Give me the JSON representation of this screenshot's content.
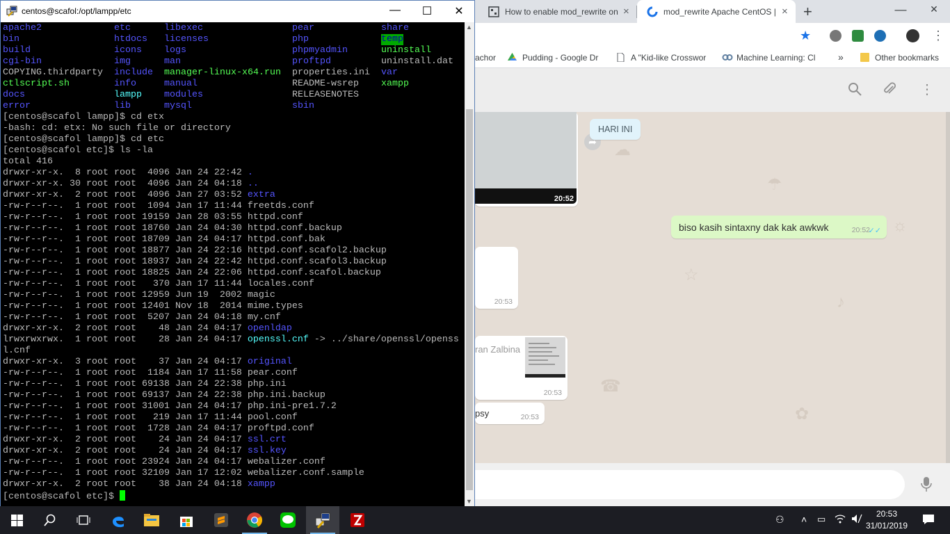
{
  "chrome": {
    "tabs": [
      {
        "title": "How to enable mod_rewrite on",
        "close": "×"
      },
      {
        "title": "mod_rewrite Apache CentOS |",
        "close": "×"
      }
    ],
    "new_tab": "+",
    "window_controls": {
      "minimize": "—",
      "maximize": "❐",
      "close": "✕"
    },
    "bookmarks": [
      {
        "label": "achor",
        "icon": "bookmark-page-icon"
      },
      {
        "label": "Pudding - Google Dr",
        "icon": "google-drive-icon"
      },
      {
        "label": "A \"Kid-like Crosswor",
        "icon": "page-icon"
      },
      {
        "label": "Machine Learning: Cl",
        "icon": "link-icon"
      }
    ],
    "bookmarks_overflow": "»",
    "other_bookmarks": "Other bookmarks",
    "colors": {
      "accent": "#1a73e8",
      "tabstrip": "#dee1e6"
    }
  },
  "whatsapp": {
    "date_chip": "HARI INI",
    "image_time": "20:52",
    "outgoing": {
      "text": "biso kasih sintaxny dak kak awkwk",
      "time": "20:52",
      "ticks": "✓✓"
    },
    "incoming": [
      {
        "text": "",
        "time": "20:53"
      },
      {
        "text": "ran Zalbina",
        "time": "20:53"
      },
      {
        "text": "psy",
        "time": "20:53"
      }
    ],
    "colors": {
      "bg": "#e5ddd5",
      "outgoing": "#dcf8c6",
      "header": "#ededed"
    }
  },
  "putty": {
    "title": "centos@scafol:/opt/lampp/etc",
    "window_controls": {
      "minimize": "—",
      "maximize": "☐",
      "close": "✕"
    },
    "ls_rows": [
      [
        "apache2",
        "etc",
        "libexec",
        "pear",
        "share"
      ],
      [
        "bin",
        "htdocs",
        "licenses",
        "php",
        "temp"
      ],
      [
        "build",
        "icons",
        "logs",
        "phpmyadmin",
        "uninstall"
      ],
      [
        "cgi-bin",
        "img",
        "man",
        "proftpd",
        "uninstall.dat"
      ],
      [
        "COPYING.thirdparty",
        "include",
        "manager-linux-x64.run",
        "properties.ini",
        "var"
      ],
      [
        "ctlscript.sh",
        "info",
        "manual",
        "README-wsrep",
        "xampp"
      ],
      [
        "docs",
        "lampp",
        "modules",
        "RELEASENOTES",
        ""
      ],
      [
        "error",
        "lib",
        "mysql",
        "sbin",
        ""
      ]
    ],
    "ls_colors": [
      [
        "blu",
        "blu",
        "blu",
        "blu",
        "blu"
      ],
      [
        "blu",
        "blu",
        "blu",
        "blu",
        "hl"
      ],
      [
        "blu",
        "blu",
        "blu",
        "blu",
        "grn"
      ],
      [
        "blu",
        "blu",
        "blu",
        "blu",
        "plain"
      ],
      [
        "plain",
        "blu",
        "grn",
        "plain",
        "blu"
      ],
      [
        "grn",
        "blu",
        "blu",
        "plain",
        "grn"
      ],
      [
        "blu",
        "cyn",
        "blu",
        "plain",
        ""
      ],
      [
        "blu",
        "blu",
        "blu",
        "blu",
        ""
      ]
    ],
    "command_lines": [
      "[centos@scafol lampp]$ cd etx",
      "-bash: cd: etx: No such file or directory",
      "[centos@scafol lampp]$ cd etc",
      "[centos@scafol etc]$ ls -la",
      "total 416"
    ],
    "listing": [
      {
        "meta": "drwxr-xr-x.  8 root root  4096 Jan 24 22:42 ",
        "name": ".",
        "style": "blu"
      },
      {
        "meta": "drwxr-xr-x. 30 root root  4096 Jan 24 04:18 ",
        "name": "..",
        "style": "blu"
      },
      {
        "meta": "drwxr-xr-x.  2 root root  4096 Jan 27 03:52 ",
        "name": "extra",
        "style": "blu"
      },
      {
        "meta": "-rw-r--r--.  1 root root  1094 Jan 17 11:44 ",
        "name": "freetds.conf",
        "style": "plain"
      },
      {
        "meta": "-rw-r--r--.  1 root root 19159 Jan 28 03:55 ",
        "name": "httpd.conf",
        "style": "plain"
      },
      {
        "meta": "-rw-r--r--.  1 root root 18760 Jan 24 04:30 ",
        "name": "httpd.conf.backup",
        "style": "plain"
      },
      {
        "meta": "-rw-r--r--.  1 root root 18709 Jan 24 04:17 ",
        "name": "httpd.conf.bak",
        "style": "plain"
      },
      {
        "meta": "-rw-r--r--.  1 root root 18877 Jan 24 22:16 ",
        "name": "httpd.conf.scafol2.backup",
        "style": "plain"
      },
      {
        "meta": "-rw-r--r--.  1 root root 18937 Jan 24 22:42 ",
        "name": "httpd.conf.scafol3.backup",
        "style": "plain"
      },
      {
        "meta": "-rw-r--r--.  1 root root 18825 Jan 24 22:06 ",
        "name": "httpd.conf.scafol.backup",
        "style": "plain"
      },
      {
        "meta": "-rw-r--r--.  1 root root   370 Jan 17 11:44 ",
        "name": "locales.conf",
        "style": "plain"
      },
      {
        "meta": "-rw-r--r--.  1 root root 12959 Jun 19  2002 ",
        "name": "magic",
        "style": "plain"
      },
      {
        "meta": "-rw-r--r--.  1 root root 12401 Nov 18  2014 ",
        "name": "mime.types",
        "style": "plain"
      },
      {
        "meta": "-rw-r--r--.  1 root root  5207 Jan 24 04:18 ",
        "name": "my.cnf",
        "style": "plain"
      },
      {
        "meta": "drwxr-xr-x.  2 root root    48 Jan 24 04:17 ",
        "name": "openldap",
        "style": "blu"
      },
      {
        "meta": "lrwxrwxrwx.  1 root root    28 Jan 24 04:17 ",
        "name": "openssl.cnf",
        "style": "cyn",
        "suffix": " -> ../share/openssl/openss"
      },
      {
        "meta": "l.cnf",
        "name": "",
        "style": "plain"
      },
      {
        "meta": "drwxr-xr-x.  3 root root    37 Jan 24 04:17 ",
        "name": "original",
        "style": "blu"
      },
      {
        "meta": "-rw-r--r--.  1 root root  1184 Jan 17 11:58 ",
        "name": "pear.conf",
        "style": "plain"
      },
      {
        "meta": "-rw-r--r--.  1 root root 69138 Jan 24 22:38 ",
        "name": "php.ini",
        "style": "plain"
      },
      {
        "meta": "-rw-r--r--.  1 root root 69137 Jan 24 22:38 ",
        "name": "php.ini.backup",
        "style": "plain"
      },
      {
        "meta": "-rw-r--r--.  1 root root 31001 Jan 24 04:17 ",
        "name": "php.ini-pre1.7.2",
        "style": "plain"
      },
      {
        "meta": "-rw-r--r--.  1 root root   219 Jan 17 11:44 ",
        "name": "pool.conf",
        "style": "plain"
      },
      {
        "meta": "-rw-r--r--.  1 root root  1728 Jan 24 04:17 ",
        "name": "proftpd.conf",
        "style": "plain"
      },
      {
        "meta": "drwxr-xr-x.  2 root root    24 Jan 24 04:17 ",
        "name": "ssl.crt",
        "style": "blu"
      },
      {
        "meta": "drwxr-xr-x.  2 root root    24 Jan 24 04:17 ",
        "name": "ssl.key",
        "style": "blu"
      },
      {
        "meta": "-rw-r--r--.  1 root root 23924 Jan 24 04:17 ",
        "name": "webalizer.conf",
        "style": "plain"
      },
      {
        "meta": "-rw-r--r--.  1 root root 32109 Jan 17 12:02 ",
        "name": "webalizer.conf.sample",
        "style": "plain"
      },
      {
        "meta": "drwxr-xr-x.  2 root root    38 Jan 24 04:18 ",
        "name": "xampp",
        "style": "blu"
      }
    ],
    "prompt": "[centos@scafol etc]$ ",
    "colors": {
      "dir": "#5555ff",
      "exec": "#55ff55",
      "link": "#55ffff",
      "text": "#bbbbbb",
      "cursor": "#00ff00"
    }
  },
  "taskbar": {
    "apps": [
      "start-icon",
      "search-icon",
      "task-view-icon",
      "edge-icon",
      "file-explorer-icon",
      "store-icon",
      "sublime-icon",
      "chrome-icon",
      "line-icon",
      "putty-icon",
      "filezilla-icon"
    ],
    "clock": {
      "time": "20:53",
      "date": "31/01/2019"
    },
    "colors": {
      "bg": "#1c1d23",
      "active": "#3b3c42"
    }
  }
}
